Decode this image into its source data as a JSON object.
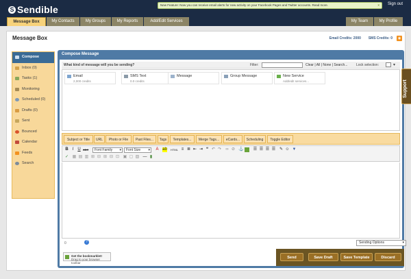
{
  "header": {
    "logo_mark": "S",
    "logo_text": "Sendible",
    "notice_text": "New Feature: Now you can receive email alerts for new activity on your Facebook Pages and Twitter accounts. Read more.",
    "notice_close": "×",
    "signout": "Sign out",
    "tabs_left": [
      {
        "label": "Message Box",
        "active": true
      },
      {
        "label": "My Contacts",
        "active": false
      },
      {
        "label": "My Groups",
        "active": false
      },
      {
        "label": "My Reports",
        "active": false
      },
      {
        "label": "Add/Edit Services",
        "active": false
      }
    ],
    "tabs_right": [
      {
        "label": "My Team"
      },
      {
        "label": "My Profile"
      }
    ]
  },
  "page": {
    "title": "Message Box",
    "email_credits": "Email Credits: 2000",
    "sms_credits": "SMS Credits: 0"
  },
  "sidebar": {
    "items": [
      {
        "label": "Compose",
        "icon": "compose-icon",
        "active": true
      },
      {
        "label": "Inbox (0)",
        "icon": "inbox-icon"
      },
      {
        "label": "Tasks (1)",
        "icon": "tasks-icon"
      },
      {
        "label": "Monitoring",
        "icon": "monitoring-icon"
      },
      {
        "label": "Scheduled (0)",
        "icon": "clock-icon"
      },
      {
        "label": "Drafts (0)",
        "icon": "drafts-icon"
      },
      {
        "label": "Sent",
        "icon": "sent-icon"
      },
      {
        "label": "Bounced",
        "icon": "bounced-icon"
      },
      {
        "label": "Calendar",
        "icon": "calendar-icon"
      },
      {
        "label": "Feeds",
        "icon": "feeds-icon"
      },
      {
        "label": "Search",
        "icon": "search-icon"
      }
    ]
  },
  "compose": {
    "title": "Compose Message",
    "question": "What kind of message will you be sending?",
    "filter_label": "Filter:",
    "filter_value": "",
    "filter_links": "Clear | All | None | Search...",
    "lock_label": "Lock selection:",
    "services": [
      {
        "title": "Email",
        "sub": "2,000 credits",
        "icon": "email-icon"
      },
      {
        "title": "SMS Text",
        "sub": "0.0 credits",
        "icon": "sms-icon"
      },
      {
        "title": "Message",
        "sub": "",
        "icon": "message-icon"
      },
      {
        "title": "Group Message",
        "sub": "",
        "icon": "group-icon"
      },
      {
        "title": "New Service",
        "sub": "Add/edit services...",
        "icon": "plus-icon"
      }
    ],
    "tabs": [
      "Subject or Title",
      "URL",
      "Photo or File",
      "Past Files...",
      "Tags",
      "Templates...",
      "Merge Tags...",
      "eCards...",
      "Scheduling",
      "Toggle Editor"
    ],
    "font_family": "Font Family",
    "font_size": "Font Size",
    "char_count": "0",
    "send_options": "Sending Options",
    "bookmarklet_title": "Get the bookmarklet!",
    "bookmarklet_sub": "Drag to your browser toolbar",
    "actions": [
      "Send",
      "Save Draft",
      "Save Template",
      "Discard"
    ]
  },
  "support_label": "Support",
  "colors": {
    "header_bg": "#1b2b44",
    "accent_orange": "#f8d89a",
    "panel_blue": "#4f7aa5",
    "action_brown": "#6b5523"
  }
}
